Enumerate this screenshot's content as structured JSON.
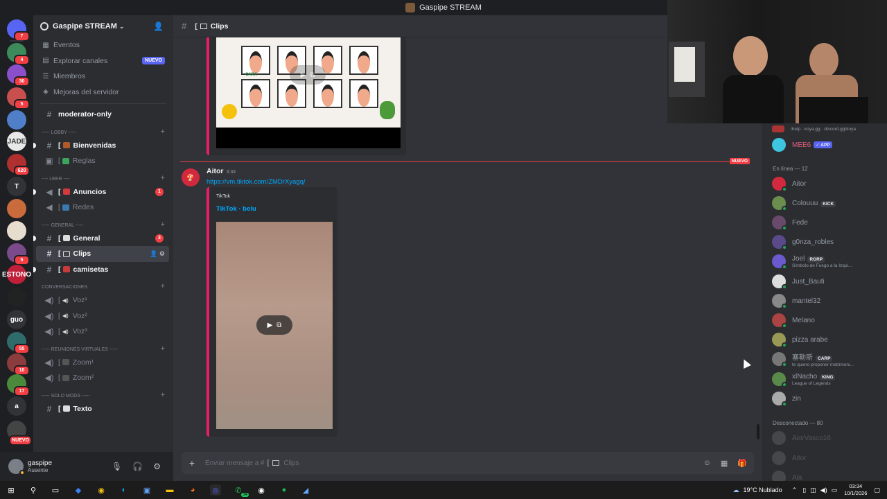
{
  "window": {
    "title": "Gaspipe STREAM"
  },
  "servers": [
    {
      "label": "",
      "badge": "7",
      "color": "#5865f2",
      "icon": "discord-home-icon"
    },
    {
      "label": "",
      "badge": "4",
      "color": "#3d8b5a"
    },
    {
      "label": "",
      "badge": "30",
      "color": "#8a4fc9"
    },
    {
      "label": "",
      "badge": "5",
      "color": "#c94f4f"
    },
    {
      "label": "",
      "badge": "",
      "color": "#4f7fc9"
    },
    {
      "label": "JADE",
      "badge": "",
      "color": "#e8e8e8"
    },
    {
      "label": "",
      "badge": "620",
      "color": "#b03030"
    },
    {
      "label": "T",
      "badge": "",
      "color": "#313338"
    },
    {
      "label": "",
      "badge": "",
      "color": "#c96b3b"
    },
    {
      "label": "",
      "badge": "",
      "color": "#e6ddcf"
    },
    {
      "label": "",
      "badge": "5",
      "color": "#7a4a8a"
    },
    {
      "label": "ESTONO",
      "badge": "",
      "color": "#c0203a"
    },
    {
      "label": "",
      "badge": "",
      "color": "#222"
    },
    {
      "label": "guo",
      "badge": "",
      "color": "#313338"
    },
    {
      "label": "",
      "badge": "55",
      "color": "#2f6b6b"
    },
    {
      "label": "",
      "badge": "10",
      "color": "#8b3d3d"
    },
    {
      "label": "",
      "badge": "17",
      "color": "#4a8a3a"
    },
    {
      "label": "a",
      "badge": "",
      "color": "#313338"
    },
    {
      "label": "",
      "badge": "NUEVO",
      "color": "#444"
    }
  ],
  "guild": {
    "name": "Gaspipe STREAM",
    "menu": [
      {
        "label": "Eventos",
        "icon": "calendar-icon"
      },
      {
        "label": "Explorar canales",
        "icon": "browse-icon",
        "pill": "NUEVO"
      },
      {
        "label": "Miembros",
        "icon": "members-icon"
      },
      {
        "label": "Mejoras del servidor",
        "icon": "boost-icon"
      }
    ],
    "moderator_channel": "moderator-only",
    "categories": {
      "lobby": "----- LOBBY -----",
      "leer": "---- LEER ----",
      "general": "----- GENERAL -----",
      "conversaciones": "CONVERSACIONES",
      "reuniones": "----- REUNIONES VIRTUALES -----",
      "solo_mods": "----- SOLO MODS -----"
    },
    "channels": {
      "bienvenidas": "Bienvenidas",
      "reglas": "Reglas",
      "anuncios": "Anuncios",
      "anuncios_count": "1",
      "redes": "Redes",
      "general": "General",
      "general_count": "3",
      "clips": "Clips",
      "camisetas": "camisetas",
      "voz1": "Voz¹",
      "voz2": "Voz²",
      "voz3": "Voz³",
      "zoom1": "Zoom¹",
      "zoom2": "Zoom²",
      "texto": "Texto"
    }
  },
  "user": {
    "name": "gaspipe",
    "status": "Ausente"
  },
  "channel_header": {
    "name": "Clips"
  },
  "messages": {
    "new_tag": "NUEVO",
    "author": "Aitor",
    "time": "3:34",
    "link": "https://vm.tiktok.com/ZMDrXyagq/",
    "embed_provider": "TikTok",
    "embed_title": "TikTok · belu",
    "embed1_caption": "CARA"
  },
  "composer": {
    "placeholder": "Enviar mensaje a #",
    "channel": "Clips"
  },
  "members": {
    "top_partial": "/help · koya.gg · discord.gg/koya",
    "mee6": {
      "name": "MEE6",
      "tag": "APP"
    },
    "online_header": "En línea — 12",
    "online": [
      {
        "name": "Aitor",
        "color": "#d1293d",
        "tag": "",
        "sub": ""
      },
      {
        "name": "Colouuu",
        "color": "#6b8e4e",
        "tag": "KICK",
        "sub": ""
      },
      {
        "name": "Fede",
        "color": "#6a4a6a",
        "tag": "",
        "sub": ""
      },
      {
        "name": "g0nza_robles",
        "color": "#5a4a8a",
        "tag": "",
        "sub": ""
      },
      {
        "name": "Joel",
        "color": "#6a5acd",
        "tag": "RGRP",
        "sub": "Símbolo de Fuego a la Izqui..."
      },
      {
        "name": "Just_Bauti",
        "color": "#ddd",
        "tag": "",
        "sub": ""
      },
      {
        "name": "mantel32",
        "color": "#888",
        "tag": "",
        "sub": ""
      },
      {
        "name": "Melano",
        "color": "#a44",
        "tag": "",
        "sub": ""
      },
      {
        "name": "pizza arabe",
        "color": "#995",
        "tag": "",
        "sub": ""
      },
      {
        "name": "塞勒斯",
        "color": "#777",
        "tag": "CARP",
        "sub": "te quiero proponer matrimoni..."
      },
      {
        "name": "xlNacho",
        "color": "#5a8a4a",
        "tag": "KING",
        "sub": "League of Legends"
      },
      {
        "name": "zin",
        "color": "#aaa",
        "tag": "",
        "sub": ""
      }
    ],
    "offline_header": "Desconectado — 80",
    "offline": [
      {
        "name": "AiorVasco16"
      },
      {
        "name": "Aitor"
      },
      {
        "name": "Ala"
      }
    ]
  },
  "taskbar": {
    "weather": "19°C Nublado",
    "time": "03:34",
    "date": "10/1/2026",
    "whatsapp_badge": "34"
  }
}
